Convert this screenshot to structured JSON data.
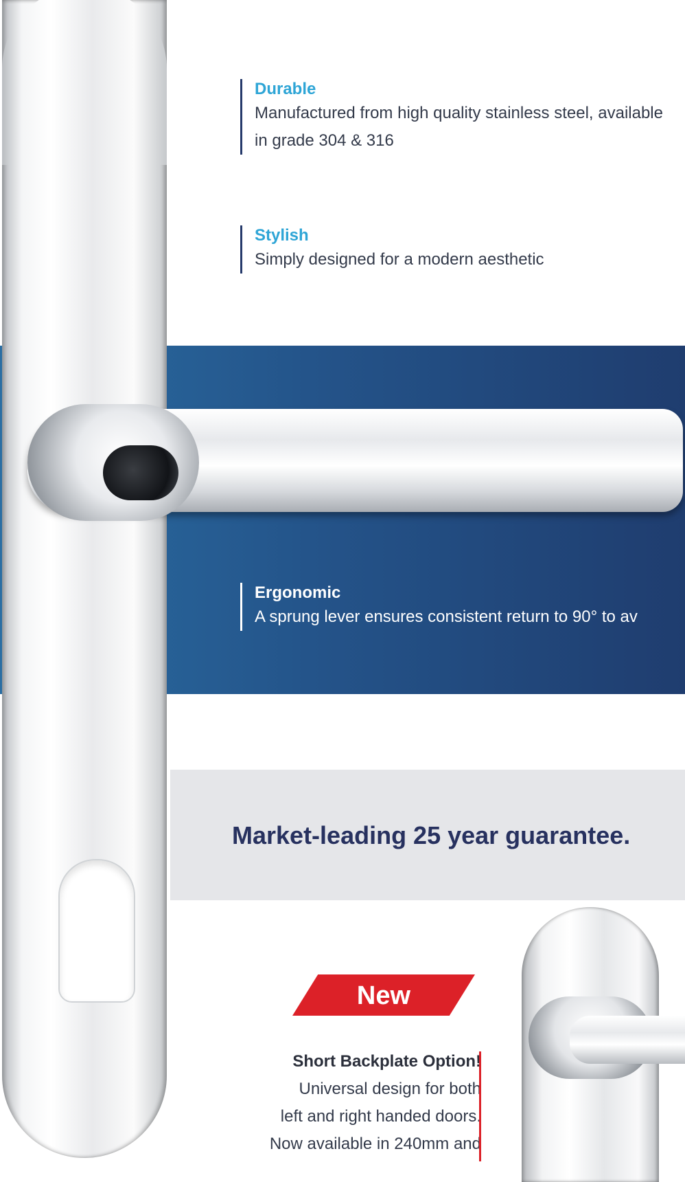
{
  "features": [
    {
      "title": "Durable",
      "description": "Manufactured from high quality stainless steel, available in grade 304 & 316",
      "title_color": "#2ea5d6"
    },
    {
      "title": "Stylish",
      "description": "Simply designed for a modern aesthetic",
      "title_color": "#2ea5d6"
    }
  ],
  "banner": {
    "title": "Ergonomic",
    "description": "A sprung lever ensures consistent return to 90° to av"
  },
  "guarantee": {
    "text": "Market-leading 25 year guarantee."
  },
  "new_badge": "New",
  "short_backplate": {
    "title": "Short Backplate Option!",
    "lines": [
      "Universal design for both",
      "left and right handed doors.",
      "Now available in 240mm and"
    ]
  },
  "colors": {
    "accent_blue": "#2ea5d6",
    "banner_dark": "#1f3d6f",
    "guarantee_text": "#27315f",
    "badge_red": "#dc2128"
  }
}
